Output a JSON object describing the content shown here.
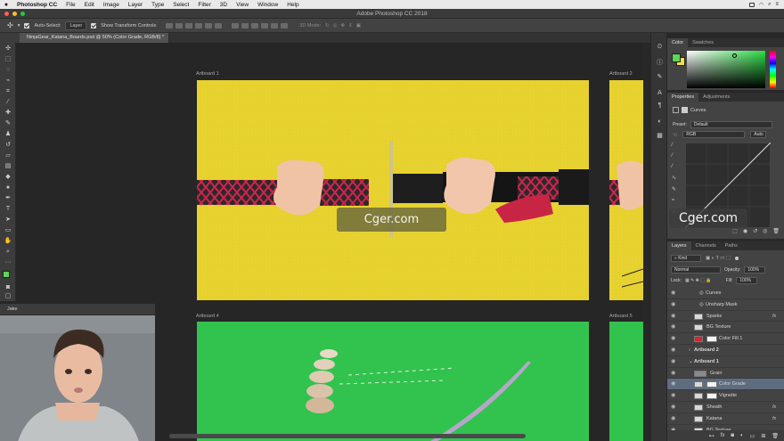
{
  "menu": {
    "app": "Photoshop CC",
    "items": [
      "File",
      "Edit",
      "Image",
      "Layer",
      "Type",
      "Select",
      "Filter",
      "3D",
      "View",
      "Window",
      "Help"
    ]
  },
  "window": {
    "title": "Adobe Photoshop CC 2018"
  },
  "options": {
    "auto_select": "Auto-Select:",
    "layer_mode": "Layer",
    "show_transform": "Show Transform Controls",
    "mode_3d": "3D Mode:"
  },
  "document": {
    "tab": "NinjaGear_Katana_Boards.psd @ 50% (Color Grade, RGB/8) *"
  },
  "artboards": [
    {
      "label": "Artboard 1"
    },
    {
      "label": "Artboard 2"
    },
    {
      "label": "Artboard 4"
    },
    {
      "label": "Artboard 5"
    }
  ],
  "watermark": {
    "text": "Cger.com"
  },
  "color_panel": {
    "tabs": [
      "Color",
      "Swatches"
    ],
    "foreground": "#5fd35a",
    "background": "#f0e04a"
  },
  "properties": {
    "tabs": [
      "Properties",
      "Adjustments"
    ],
    "type_label": "Curves",
    "preset_label": "Preset:",
    "preset_value": "Default",
    "channel": "RGB",
    "auto_button": "Auto"
  },
  "layers": {
    "tabs": [
      "Layers",
      "Channels",
      "Paths"
    ],
    "kind_filter": "Kind",
    "blend_mode": "Normal",
    "opacity_label": "Opacity:",
    "opacity_value": "100%",
    "lock_label": "Lock:",
    "fill_label": "Fill:",
    "fill_value": "100%",
    "rows": [
      {
        "name": "Curves",
        "indent": 3,
        "kind": "sub"
      },
      {
        "name": "Unsharp Mask",
        "indent": 3,
        "kind": "sub"
      },
      {
        "name": "Sparks",
        "indent": 2,
        "kind": "smart",
        "fx": "fx"
      },
      {
        "name": "BG Texture",
        "indent": 2,
        "kind": "smart"
      },
      {
        "name": "Color Fill 1",
        "indent": 2,
        "kind": "fill"
      },
      {
        "name": "Artboard 2",
        "indent": 1,
        "kind": "artboard"
      },
      {
        "name": "Artboard 1",
        "indent": 1,
        "kind": "artboard-open"
      },
      {
        "name": "Grain",
        "indent": 2,
        "kind": "normal"
      },
      {
        "name": "Color Grade",
        "indent": 2,
        "kind": "adjust",
        "selected": true
      },
      {
        "name": "Vignette",
        "indent": 2,
        "kind": "adjust"
      },
      {
        "name": "Sheath",
        "indent": 2,
        "kind": "smart",
        "fx": "fx"
      },
      {
        "name": "Katana",
        "indent": 2,
        "kind": "smart",
        "fx": "fx"
      },
      {
        "name": "BG Texture",
        "indent": 2,
        "kind": "smart"
      }
    ]
  },
  "webcam": {
    "tab": "Jake"
  }
}
